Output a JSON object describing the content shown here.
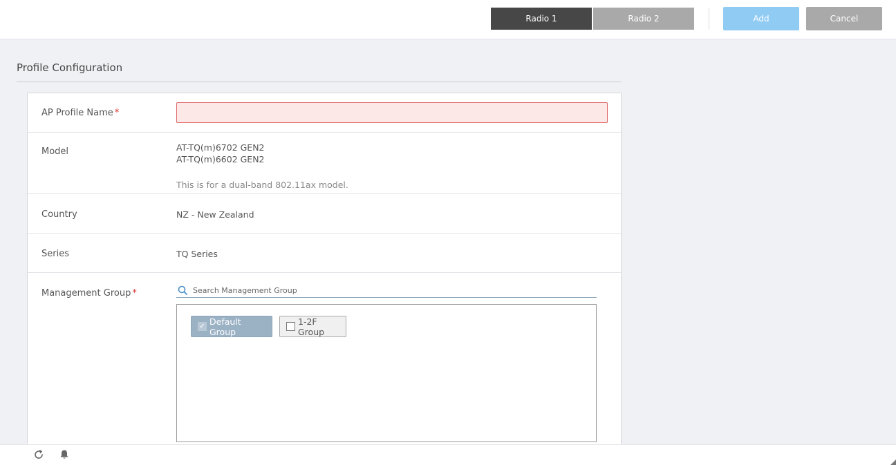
{
  "tabs": [
    {
      "label": "Radio 1",
      "active": true
    },
    {
      "label": "Radio 2",
      "active": false
    }
  ],
  "actions": {
    "add_label": "Add",
    "cancel_label": "Cancel"
  },
  "section": {
    "title": "Profile Configuration"
  },
  "form": {
    "ap_profile_name": {
      "label": "AP Profile Name",
      "required_mark": "*",
      "value": ""
    },
    "model": {
      "label": "Model",
      "values": [
        "AT-TQ(m)6702 GEN2",
        "AT-TQ(m)6602 GEN2"
      ],
      "note": "This is for a dual-band 802.11ax model."
    },
    "country": {
      "label": "Country",
      "value": "NZ - New Zealand"
    },
    "series": {
      "label": "Series",
      "value": "TQ Series"
    },
    "management_group": {
      "label": "Management Group",
      "required_mark": "*",
      "search_placeholder": "Search Management Group",
      "groups": [
        {
          "label": "Default Group",
          "checked": true
        },
        {
          "label": "1-2F Group",
          "checked": false
        }
      ]
    }
  },
  "colors": {
    "tab_active": "#474747",
    "tab_inactive": "#a9a9a9",
    "add_button": "#8fcbf3",
    "cancel_button": "#a9a9a9",
    "required": "#d9342b",
    "input_error_bg": "#fde8e8",
    "input_error_border": "#e06666",
    "chip_selected": "#9bb1c4"
  },
  "icons": {
    "search": "search-icon",
    "refresh": "refresh-icon",
    "notifications": "bell-icon"
  }
}
